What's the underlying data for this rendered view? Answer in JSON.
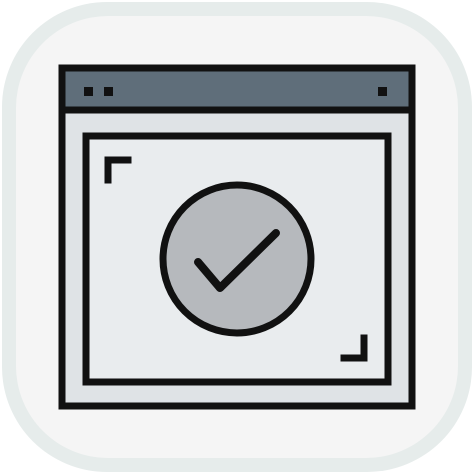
{
  "icon": {
    "name": "browser-window-checkmark-icon",
    "colors": {
      "tile_outer": "#e6eceb",
      "tile_inner": "#f5f5f5",
      "outline": "#111111",
      "title_bar": "#5f6e7a",
      "window_body": "#dfe3e6",
      "content_panel": "#e9ecee",
      "circle_fill": "#b6b9bd",
      "check_stroke": "#111111"
    }
  }
}
